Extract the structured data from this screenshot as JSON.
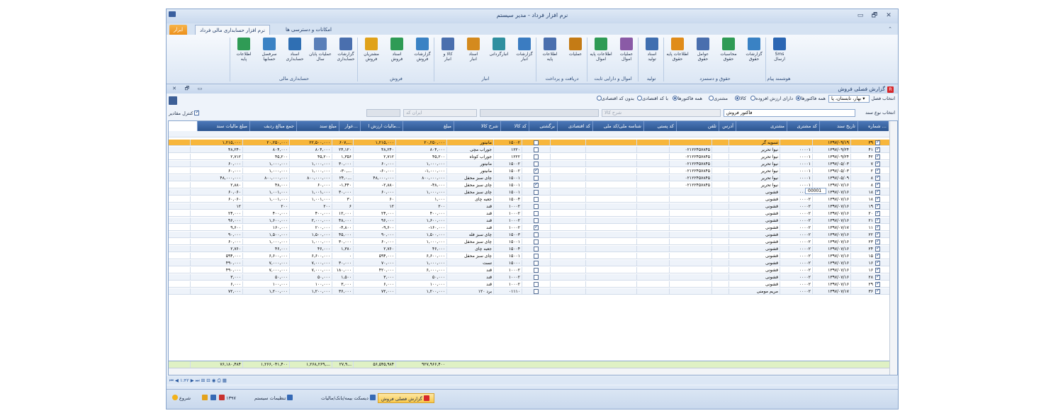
{
  "window": {
    "title": "نرم افزار فرداد - مدیر سیستم"
  },
  "ribbon_tabs": {
    "accounting": "نرم افزار حسابداری مالی فرداد",
    "access": "امکانات و دسترسی ها",
    "tools": "ابزار"
  },
  "ribbon_groups": {
    "sms": "هوشمند پیام",
    "payroll": "حقوق و دستمزد",
    "production": "تولید",
    "assets": "اموال و دارایی ثابت",
    "receive_pay": "دریافت و پرداخت",
    "warehouse": "انبار",
    "sales": "فروش",
    "finance": "حسابداری مالی"
  },
  "ribbon_buttons": [
    {
      "label": "Sms\nارسال"
    },
    {
      "label": "گزارشات\nحقوق"
    },
    {
      "label": "محاسبات\nحقوق"
    },
    {
      "label": "عوامل\nحقوق"
    },
    {
      "label": "اطلاعات پایه\nحقوق"
    },
    {
      "label": "اسناد\nتولید"
    },
    {
      "label": "عملیات\nاموال"
    },
    {
      "label": "اطلاعات پایه\nاموال"
    },
    {
      "label": "عملیات"
    },
    {
      "label": "اطلاعات\nپایه"
    },
    {
      "label": "گزارشات\nانبار"
    },
    {
      "label": "انبارگردانی"
    },
    {
      "label": "اسناد\nانبار"
    },
    {
      "label": "کالا و\nانبار"
    },
    {
      "label": "گزارشات\nفروش"
    },
    {
      "label": "اسناد\nفروش"
    },
    {
      "label": "مشتریان\nفروش"
    },
    {
      "label": "گزارشات\nحسابداری"
    },
    {
      "label": "عملیات پایان\nسال"
    },
    {
      "label": "اسناد\nحسابداری"
    },
    {
      "label": "سرفصل\nحسابها"
    },
    {
      "label": "اطلاعات\nپایه"
    }
  ],
  "child_window": {
    "title": "گزارش فصلی فروش",
    "badge": "R"
  },
  "filters": {
    "season_label": "انتخاب فصل",
    "season_value": "بهار، تابستان، پا",
    "doc_type_label": "انتخاب نوع سند",
    "doc_type_value": "فاکتور فروش",
    "opt_all_invoices": "همه فاکتورها",
    "opt_vat": "دارای ارزش افزوده",
    "opt_goods": "کالا",
    "opt_customer": "مشتری",
    "opt_all_invoices2": "همه فاکتورها",
    "opt_with_econ": "با کد اقتصادی",
    "opt_without_econ": "بدون کد اقتصادی",
    "goods_desc_placeholder": "شرح کالا",
    "iran_code_placeholder": "ایران کد",
    "control_amounts": "کنترل مقادیر"
  },
  "columns": [
    "شماره ...",
    "تاریخ سند",
    "کد مشتری",
    "مشتری",
    "آدرس",
    "تلفن",
    "کد پستی",
    "شناسه ملی/کد ملی",
    "کد اقتصادی",
    "برگشتی",
    "کد کالا",
    "شرح کالا",
    "مبلغ",
    "مالیات ارزش ا...",
    "عوار...",
    "مبلغ سند",
    "جمع مبالغ ردیف",
    "مبلغ مالیات سند"
  ],
  "rows": [
    {
      "no": "۳۹",
      "date": "۱۳۹۷/۰۹/۱۹",
      "ccode": "",
      "cust": "تسویه گر",
      "tel": "",
      "ret": false,
      "gcode": "۱۵۰۰۲",
      "gdesc": "مانیتور",
      "amt": "۲۰,۲۵۰,۰۰۰",
      "vat": "۱,۲۱۵,۰۰۰",
      "fee": "۶۰۷,...",
      "doc": "۲۲,۵۰۰,۰۰۰",
      "rowsum": "۲۰,۲۵۰,۰۰۰",
      "doctax": "۱,۲۱۵,۰۰۰"
    },
    {
      "no": "۴۱",
      "date": "۱۳۹۷/۰۹/۲۴",
      "ccode": "۰۰۰۰۱",
      "cust": "نیوا تحریر",
      "tel": "۰۲۱۲۲۴۵۷۸۴۵",
      "ret": false,
      "gcode": "۱۲۲۰",
      "gdesc": "جوراب مچی",
      "amt": "۸۰۴,۰۰۰",
      "vat": "۴۸,۲۴۰",
      "fee": "۲۴,۱۲۰",
      "doc": "۸۰۴,۰۰۰",
      "rowsum": "۸۰۴,۰۰۰",
      "doctax": "۴۸,۲۴۰"
    },
    {
      "no": "۴۲",
      "date": "۱۳۹۷/۰۹/۲۴",
      "ccode": "۰۰۰۰۱",
      "cust": "نیوا تحریر",
      "tel": "۰۲۱۲۲۴۵۷۸۴۵",
      "ret": false,
      "gcode": "۱۲۲۲",
      "gdesc": "جوراب کوتاه",
      "amt": "۴۵,۲۰۰",
      "vat": "۲,۷۱۲",
      "fee": "۱,۳۵۶",
      "doc": "۴۵,۲۰۰",
      "rowsum": "۴۵,۲۰۰",
      "doctax": "۲,۷۱۲"
    },
    {
      "no": "۷",
      "date": "۱۳۹۷/۰۵/۰۳",
      "ccode": "۰۰۰۰۱",
      "cust": "نیوا تحریر",
      "tel": "۰۲۱۲۲۴۵۷۸۴۵",
      "ret": false,
      "gcode": "۱۵۰۰۲",
      "gdesc": "مانیتور",
      "amt": "۱,۰۰۰,۰۰۰",
      "vat": "۶۰,۰۰۰",
      "fee": "۳۰,۰۰۰",
      "doc": "۱,۰۰۰,۰۰۰",
      "rowsum": "۱,۰۰۰,۰۰۰",
      "doctax": "۶۰,۰۰۰"
    },
    {
      "no": "۲",
      "date": "۱۳۹۷/۰۵/۰۳",
      "ccode": "۰۰۰۰۱",
      "cust": "نیوا تحریر",
      "tel": "۰۲۱۲۲۴۵۷۸۴۵",
      "ret": true,
      "gcode": "۱۵۰۰۲",
      "gdesc": "مانیتور",
      "amt": "-۱,۰۰۰,۰۰۰",
      "vat": "-۶۰,۰۰۰",
      "fee": "-۳۰,...",
      "doc": "۱,۰۰۰,۰۰۰",
      "rowsum": "۱,۰۰۰,۰۰۰",
      "doctax": "۶۰,۰۰۰"
    },
    {
      "no": "۸",
      "date": "۱۳۹۷/۰۵/۰۹",
      "ccode": "۰۰۰۰۱",
      "cust": "نیوا تحریر",
      "tel": "۰۲۱۲۲۴۵۷۸۴۵",
      "ret": false,
      "gcode": "۱۵۰۰۱",
      "gdesc": "چای سبز محفل",
      "amt": "۸۰۰,۰۰۰,۰۰۰",
      "vat": "۴۸,۰۰۰,۰۰۰",
      "fee": "۲۴,۰...",
      "doc": "۸۰۰,۰۰۰,۰۰۰",
      "rowsum": "۸۰۰,۰۰۰,۰۰۰",
      "doctax": "۴۸,۰۰۰,۰۰۰"
    },
    {
      "no": "۸",
      "date": "۱۳۹۷/۰۷/۱۶",
      "ccode": "۰۰۰۰۱",
      "cust": "نیوا تحریر",
      "tel": "۰۲۱۲۲۴۵۷۸۴۵",
      "ret": true,
      "gcode": "۱۵۰۰۱",
      "gdesc": "چای سبز محفل",
      "amt": "-۴۸,۰۰۰",
      "vat": "-۲,۸۸۰",
      "fee": "-۱,۴۴۰",
      "doc": "۶۰,۰۰۰",
      "rowsum": "۴۸,۰۰۰",
      "doctax": "۲,۸۸۰"
    },
    {
      "no": "۱۸",
      "date": "۱۳۹۷/۰۷/۱۶",
      "ccode": "۰۰۰۰۱",
      "cust": "قشونی",
      "tel": "",
      "ret": false,
      "gcode": "۱۵۰۰۱",
      "gdesc": "چای سبز محفل",
      "amt": "۱,۰۰۰,۰۰۰",
      "vat": "۶۰,۰۰۰",
      "fee": "۳۰,۰۰۰",
      "doc": "۱,۰۰۱,۰۰۰",
      "rowsum": "۱,۰۰۱,۰۰۰",
      "doctax": "۶۰,۰۶۰"
    },
    {
      "no": "۱۸",
      "date": "۱۳۹۷/۰۷/۱۶",
      "ccode": "۰۰۰۰۲",
      "cust": "قشونی",
      "tel": "",
      "ret": false,
      "gcode": "۱۵۰۰۴",
      "gdesc": "جعبه چای",
      "amt": "۱,۰۰۰",
      "vat": "۶۰",
      "fee": "۳۰",
      "doc": "۱,۰۰۱,۰۰۰",
      "rowsum": "۱,۰۰۱,۰۰۰",
      "doctax": "۶۰,۰۶۰"
    },
    {
      "no": "۱۹",
      "date": "۱۳۹۷/۰۷/۱۶",
      "ccode": "۰۰۰۰۲",
      "cust": "قشونی",
      "tel": "",
      "ret": false,
      "gcode": "۱۰۰۰۲",
      "gdesc": "قند",
      "amt": "۲۰۰",
      "vat": "۱۲",
      "fee": "۶",
      "doc": "۲۰۰",
      "rowsum": "۲۰۰",
      "doctax": "۱۲"
    },
    {
      "no": "۲۰",
      "date": "۱۳۹۷/۰۷/۱۶",
      "ccode": "۰۰۰۰۲",
      "cust": "قشونی",
      "tel": "",
      "ret": false,
      "gcode": "۱۰۰۰۲",
      "gdesc": "قند",
      "amt": "۴۰۰,۰۰۰",
      "vat": "۲۴,۰۰۰",
      "fee": "۱۲,۰۰۰",
      "doc": "۴۰۰,۰۰۰",
      "rowsum": "۴۰۰,۰۰۰",
      "doctax": "۲۴,۰۰۰"
    },
    {
      "no": "۲۱",
      "date": "۱۳۹۷/۰۷/۱۶",
      "ccode": "۰۰۰۰۲",
      "cust": "قشونی",
      "tel": "",
      "ret": false,
      "gcode": "۱۰۰۰۲",
      "gdesc": "قند",
      "amt": "۱,۶۰۰,۰۰۰",
      "vat": "۹۶,۰۰۰",
      "fee": "۴۸,۰۰۰",
      "doc": "۲,۰۰۰,۰۰۰",
      "rowsum": "۱,۶۰۰,۰۰۰",
      "doctax": "۹۶,۰۰۰"
    },
    {
      "no": "۱۱",
      "date": "۱۳۹۷/۰۷/۱۷",
      "ccode": "۰۰۰۰۲",
      "cust": "قشونی",
      "tel": "",
      "ret": true,
      "gcode": "۱۰۰۰۲",
      "gdesc": "قند",
      "amt": "-۱۶۰,۰۰۰",
      "vat": "-۹,۶۰۰",
      "fee": "-۴,۸۰۰",
      "doc": "۲۰۰,۰۰۰",
      "rowsum": "۱۶۰,۰۰۰",
      "doctax": "۹,۶۰۰"
    },
    {
      "no": "۲۲",
      "date": "۱۳۹۷/۰۷/۱۶",
      "ccode": "۰۰۰۰۲",
      "cust": "قشونی",
      "tel": "",
      "ret": false,
      "gcode": "۱۵۰۰۳",
      "gdesc": "چای سبز فله",
      "amt": "۱,۵۰۰,۰۰۰",
      "vat": "۹۰,۰۰۰",
      "fee": "۴۵,۰۰۰",
      "doc": "۱,۵۰۰,۰۰۰",
      "rowsum": "۱,۵۰۰,۰۰۰",
      "doctax": "۹۰,۰۰۰"
    },
    {
      "no": "۲۳",
      "date": "۱۳۹۷/۰۷/۱۶",
      "ccode": "۰۰۰۰۲",
      "cust": "قشونی",
      "tel": "",
      "ret": false,
      "gcode": "۱۵۰۰۱",
      "gdesc": "چای سبز محفل",
      "amt": "۱,۰۰۰,۰۰۰",
      "vat": "۶۰,۰۰۰",
      "fee": "۳۰,۰۰۰",
      "doc": "۱,۰۰۰,۰۰۰",
      "rowsum": "۱,۰۰۰,۰۰۰",
      "doctax": "۶۰,۰۰۰"
    },
    {
      "no": "۲۴",
      "date": "۱۳۹۷/۰۷/۱۶",
      "ccode": "۰۰۰۰۲",
      "cust": "قشونی",
      "tel": "",
      "ret": false,
      "gcode": "۱۵۰۰۴",
      "gdesc": "جعبه چای",
      "amt": "۴۶,۰۰۰",
      "vat": "۲,۷۶۰",
      "fee": "۱,۳۸۰",
      "doc": "۴۶,۰۰۰",
      "rowsum": "۴۶,۰۰۰",
      "doctax": "۲,۷۶۰"
    },
    {
      "no": "۱۵",
      "date": "۱۳۹۷/۰۷/۱۶",
      "ccode": "۰۰۰۰۲",
      "cust": "قشونی",
      "tel": "",
      "ret": false,
      "gcode": "۱۵۰۰۱",
      "gdesc": "چای سبز محفل",
      "amt": "۶,۶۰۰,۰۰۰",
      "vat": "۵۹۴,۰۰۰",
      "fee": "۰",
      "doc": "۶,۶۰۰,۰۰۰",
      "rowsum": "۶,۶۰۰,۰۰۰",
      "doctax": "۵۹۴,۰۰۰"
    },
    {
      "no": "۱۶",
      "date": "۱۳۹۷/۰۷/۱۶",
      "ccode": "۰۰۰۰۲",
      "cust": "قشونی",
      "tel": "",
      "ret": false,
      "gcode": "۱۵۰۰۰",
      "gdesc": "تست",
      "amt": "۱,۰۰۰,۰۰۰",
      "vat": "۷۰,۰۰۰",
      "fee": "۳۰,۰۰۰",
      "doc": "۷,۰۰۰,۰۰۰",
      "rowsum": "۷,۰۰۰,۰۰۰",
      "doctax": "۴۹۰,۰۰۰"
    },
    {
      "no": "۱۶",
      "date": "۱۳۹۷/۰۷/۱۶",
      "ccode": "۰۰۰۰۲",
      "cust": "قشونی",
      "tel": "",
      "ret": false,
      "gcode": "۱۰۰۰۲",
      "gdesc": "قند",
      "amt": "۶,۰۰۰,۰۰۰",
      "vat": "۴۲۰,۰۰۰",
      "fee": "۱۸۰,۰۰۰",
      "doc": "۷,۰۰۰,۰۰۰",
      "rowsum": "۷,۰۰۰,۰۰۰",
      "doctax": "۴۹۰,۰۰۰"
    },
    {
      "no": "۲۸",
      "date": "۱۳۹۷/۰۷/۱۶",
      "ccode": "۰۰۰۰۲",
      "cust": "قشونی",
      "tel": "",
      "ret": false,
      "gcode": "۱۰۰۰۲",
      "gdesc": "قند",
      "amt": "۵۰,۰۰۰",
      "vat": "۳,۰۰۰",
      "fee": "۱,۵۰۰",
      "doc": "۵۰,۰۰۰",
      "rowsum": "۵۰,۰۰۰",
      "doctax": "۳,۰۰۰"
    },
    {
      "no": "۲۹",
      "date": "۱۳۹۷/۰۷/۱۶",
      "ccode": "۰۰۰۰۲",
      "cust": "قشونی",
      "tel": "",
      "ret": false,
      "gcode": "۱۰۰۰۲",
      "gdesc": "قند",
      "amt": "۱۰۰,۰۰۰",
      "vat": "۶,۰۰۰",
      "fee": "۳,۰۰۰",
      "doc": "۱۰۰,۰۰۰",
      "rowsum": "۱۰۰,۰۰۰",
      "doctax": "۶,۰۰۰"
    },
    {
      "no": "۳۶",
      "date": "۱۳۹۷/۰۷/۱۷",
      "ccode": "۰۰۰۰۲",
      "cust": "مریم مومنی",
      "tel": "",
      "ret": false,
      "gcode": "۰۱۱۱۰",
      "gdesc": "برد ۱۲۰",
      "amt": "۱,۲۰۰,۰۰۰",
      "vat": "۷۲,۰۰۰",
      "fee": "۳۶,۰۰۰",
      "doc": "۱,۲۰۰,۰۰۰",
      "rowsum": "۱,۲۰۰,۰۰۰",
      "doctax": "۷۲,۰۰۰"
    }
  ],
  "totals": {
    "amt": "۹۲۷,۹۶۶,۴۰۰",
    "vat": "۵۶,۵۴۵,۹۸۴",
    "fee": "۲۷,۹...",
    "doc": "۱,۲۶۸,۲۶۹,...",
    "rowsum": "۱,۲۶۶,۰۴۱,۴۰۰",
    "doctax": "۷۶,۱۸۰,۴۸۴"
  },
  "tooltip": "00001",
  "nav": {
    "page": "۱:۴۲"
  },
  "taskbar": {
    "start": "شروع",
    "year": "۱۳۹۷",
    "settings": "تنظیمات سیستم",
    "desk": "دیسکت بیمه/بانک/مالیات",
    "report": "گزارش فصلی فروش"
  }
}
